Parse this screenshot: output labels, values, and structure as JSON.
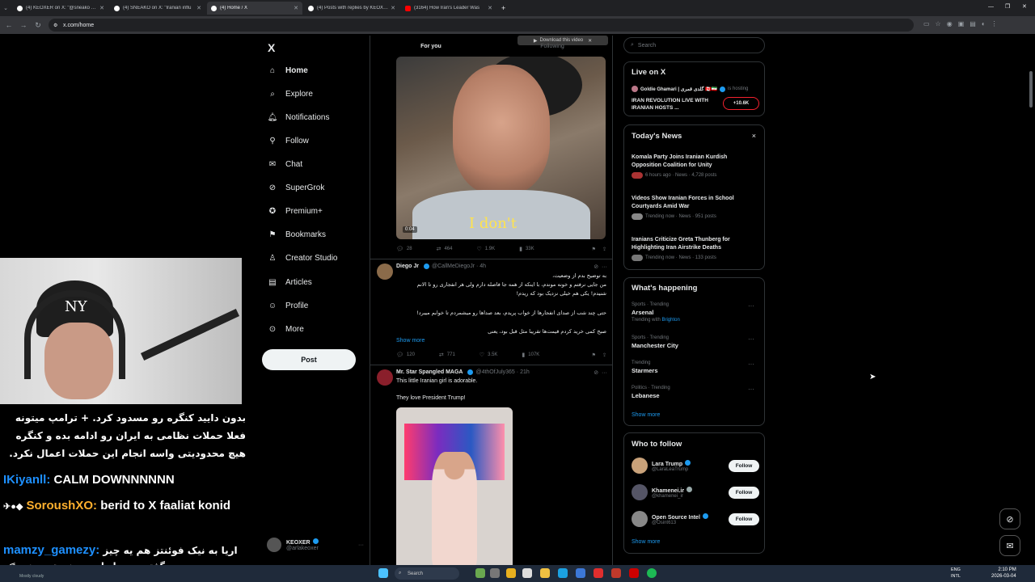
{
  "browser": {
    "tabs": [
      {
        "label": "(4) KEOXER on X: \"@sneako I'm",
        "active": false
      },
      {
        "label": "(4) SNEAKO on X: \"Iranian influ",
        "active": false
      },
      {
        "label": "(4) Home / X",
        "active": true
      },
      {
        "label": "(4) Posts with replies by KEOXER",
        "active": false
      },
      {
        "label": "(3164) How Iran's Leader Was",
        "active": false
      }
    ],
    "url": "x.com/home"
  },
  "nav": {
    "logo": "X",
    "items": [
      {
        "label": "Home",
        "icon": "home-icon"
      },
      {
        "label": "Explore",
        "icon": "search-icon"
      },
      {
        "label": "Notifications",
        "icon": "bell-icon"
      },
      {
        "label": "Follow",
        "icon": "person-add-icon"
      },
      {
        "label": "Chat",
        "icon": "mail-icon"
      },
      {
        "label": "SuperGrok",
        "icon": "grok-icon"
      },
      {
        "label": "Premium+",
        "icon": "premium-icon"
      },
      {
        "label": "Bookmarks",
        "icon": "bookmark-icon"
      },
      {
        "label": "Creator Studio",
        "icon": "creator-icon"
      },
      {
        "label": "Articles",
        "icon": "articles-icon"
      },
      {
        "label": "Profile",
        "icon": "profile-icon"
      },
      {
        "label": "More",
        "icon": "more-icon"
      }
    ],
    "post_label": "Post",
    "account": {
      "name": "KEOXER",
      "handle": "@arlakeoxer"
    }
  },
  "feed": {
    "tabs": [
      "For you",
      "Following"
    ],
    "download_pill": "Download this video",
    "video1": {
      "caption": "I don't",
      "time": "0:04",
      "stats": {
        "replies": "28",
        "reposts": "464",
        "likes": "1.9K",
        "views": "33K"
      }
    },
    "post2": {
      "name": "Diego Jr",
      "handle": "@CallMeDiegoJr",
      "time": "4h",
      "lines": [
        "به توضیح بدم از وضعیت،",
        "من جایی نرفتم و خونه موندم، با اینکه از همه جا فاصله دارم ولی هر انفجاری رو تا الانم",
        "شنیدم! یکی هم خیلی نزدیک بود که ریدم!",
        "حتی چند شب از صدای انفجارها از خواب پریدم، بعد صداها رو میشمردم تا خوابم میبرد!",
        "صبح کمی خرید کردم قیمت‌ها تقریبا مثل قبل بود، یعنی"
      ],
      "show_more": "Show more",
      "stats": {
        "replies": "120",
        "reposts": "771",
        "likes": "3.5K",
        "views": "107K"
      }
    },
    "post3": {
      "name": "Mr. Star Spangled MAGA",
      "handle": "@4thOfJuly365",
      "time": "21h",
      "text1": "This little Iranian girl is adorable.",
      "text2": "They love President Trump!"
    }
  },
  "right": {
    "search_placeholder": "Search",
    "live": {
      "title": "Live on X",
      "host": "Goldie Ghamari | گلدی قمری 🇨🇦🇮🇷",
      "host_status": "is hosting",
      "stream_title": "IRAN REVOLUTION LIVE WITH IRANIAN HOSTS ...",
      "count": "+10.6K"
    },
    "news": {
      "title": "Today's News",
      "close": "×",
      "items": [
        {
          "title": "Komala Party Joins Iranian Kurdish Opposition Coalition for Unity",
          "meta": "6 hours ago · News · 4,728 posts"
        },
        {
          "title": "Videos Show Iranian Forces in School Courtyards Amid War",
          "meta": "Trending now · News · 951 posts"
        },
        {
          "title": "Iranians Criticize Greta Thunberg for Highlighting Iran Airstrike Deaths",
          "meta": "Trending now · News · 133 posts"
        }
      ]
    },
    "happening": {
      "title": "What's happening",
      "items": [
        {
          "context": "Sports · Trending",
          "title": "Arsenal",
          "with_label": "Trending with",
          "with_link": "Brighton"
        },
        {
          "context": "Sports · Trending",
          "title": "Manchester City",
          "with_label": "",
          "with_link": ""
        },
        {
          "context": "Trending",
          "title": "Starmers",
          "with_label": "",
          "with_link": ""
        },
        {
          "context": "Politics · Trending",
          "title": "Lebanese",
          "with_label": "",
          "with_link": ""
        }
      ],
      "show_more": "Show more"
    },
    "who": {
      "title": "Who to follow",
      "items": [
        {
          "name": "Lara Trump",
          "handle": "@LaraLeaTrump",
          "button": "Follow"
        },
        {
          "name": "Khamenei.ir",
          "handle": "@khamenei_ir",
          "button": "Follow"
        },
        {
          "name": "Open Source Intel",
          "handle": "@Osint613",
          "button": "Follow"
        }
      ],
      "show_more": "Show more"
    }
  },
  "overlay": {
    "persian_msg": "بدون دایید کنگره رو مسدود کرد. + ترامپ میتونه فعلا حملات نظامی به ایران رو ادامه بده و کنگره هیچ محدودیتی واسه انجام این حملات اعمال نکرد.",
    "chat": [
      {
        "user": "IKiyanll:",
        "text": "CALM DOWNNNNNN"
      },
      {
        "user": "SoroushXO:",
        "text": "berid to X faaliat konid"
      },
      {
        "user": "mamzy_gamezy:",
        "text": "اریا به نیک فوئنتز هم یه چیز بگو"
      }
    ],
    "persian_msg2": "گفته مردم ایران بسوزن تو جهنم",
    "webcam_logo": "NY"
  },
  "taskbar": {
    "search": "Search",
    "lang": "ENG",
    "lang2": "INTL",
    "time": "2:10 PM",
    "date": "2026-03-04",
    "weather": "Mostly cloudy"
  },
  "colors": {
    "accent": "#1d9bf0",
    "background": "#000000",
    "border": "#2f3336"
  }
}
